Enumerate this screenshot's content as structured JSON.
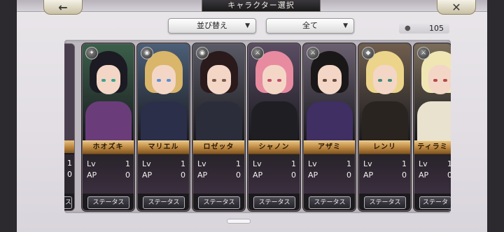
{
  "header": {
    "title": "キャラクター選択",
    "back_icon": "left-arrow-icon",
    "close_icon": "close-icon"
  },
  "filters": {
    "sort_label": "並び替え",
    "filter_label": "全て",
    "caret": "▼"
  },
  "count": {
    "value": "105",
    "icon": "person-icon"
  },
  "stat_labels": {
    "lv": "Lv",
    "ap": "AP"
  },
  "status_button_label": "ステータス",
  "partial_left": {
    "status_button_label": "ス"
  },
  "cards": [
    {
      "name": "ホオズキ",
      "lv": "1",
      "ap": "0",
      "weapon_icon": "staff-icon",
      "weapon_glyph": "✦",
      "palette": {
        "bg": "#3b5f4a",
        "hair": "#1c1a22",
        "body": "#6a3d7a",
        "eye": "#3aa58a"
      }
    },
    {
      "name": "マリエル",
      "lv": "1",
      "ap": "0",
      "weapon_icon": "orb-icon",
      "weapon_glyph": "◉",
      "palette": {
        "bg": "#4b5f78",
        "hair": "#d9b66a",
        "body": "#2b2f4a",
        "eye": "#5b8fd6"
      }
    },
    {
      "name": "ロゼッタ",
      "lv": "1",
      "ap": "0",
      "weapon_icon": "orb-icon",
      "weapon_glyph": "◉",
      "palette": {
        "bg": "#5a5a66",
        "hair": "#2a1a1c",
        "body": "#2b2d3a",
        "eye": "#7a5c4a"
      }
    },
    {
      "name": "シャノン",
      "lv": "1",
      "ap": "0",
      "weapon_icon": "sword-icon",
      "weapon_glyph": "⚔",
      "palette": {
        "bg": "#5a4d63",
        "hair": "#e88ba0",
        "body": "#1f1e23",
        "eye": "#c04d6a"
      }
    },
    {
      "name": "アザミ",
      "lv": "1",
      "ap": "0",
      "weapon_icon": "sword-icon",
      "weapon_glyph": "⚔",
      "palette": {
        "bg": "#6a6070",
        "hair": "#1a1718",
        "body": "#3f2f63",
        "eye": "#6a4a3a"
      }
    },
    {
      "name": "レンリ",
      "lv": "1",
      "ap": "0",
      "weapon_icon": "shield-icon",
      "weapon_glyph": "◆",
      "palette": {
        "bg": "#705e4e",
        "hair": "#ecd58a",
        "body": "#2a2420",
        "eye": "#3c8c74"
      }
    },
    {
      "name": "ティラミ",
      "lv": "1",
      "ap": "0",
      "weapon_icon": "sword-icon",
      "weapon_glyph": "⚔",
      "palette": {
        "bg": "#7a6d5a",
        "hair": "#f0e6b4",
        "body": "#e9e2cf",
        "eye": "#b34a4a"
      }
    }
  ]
}
